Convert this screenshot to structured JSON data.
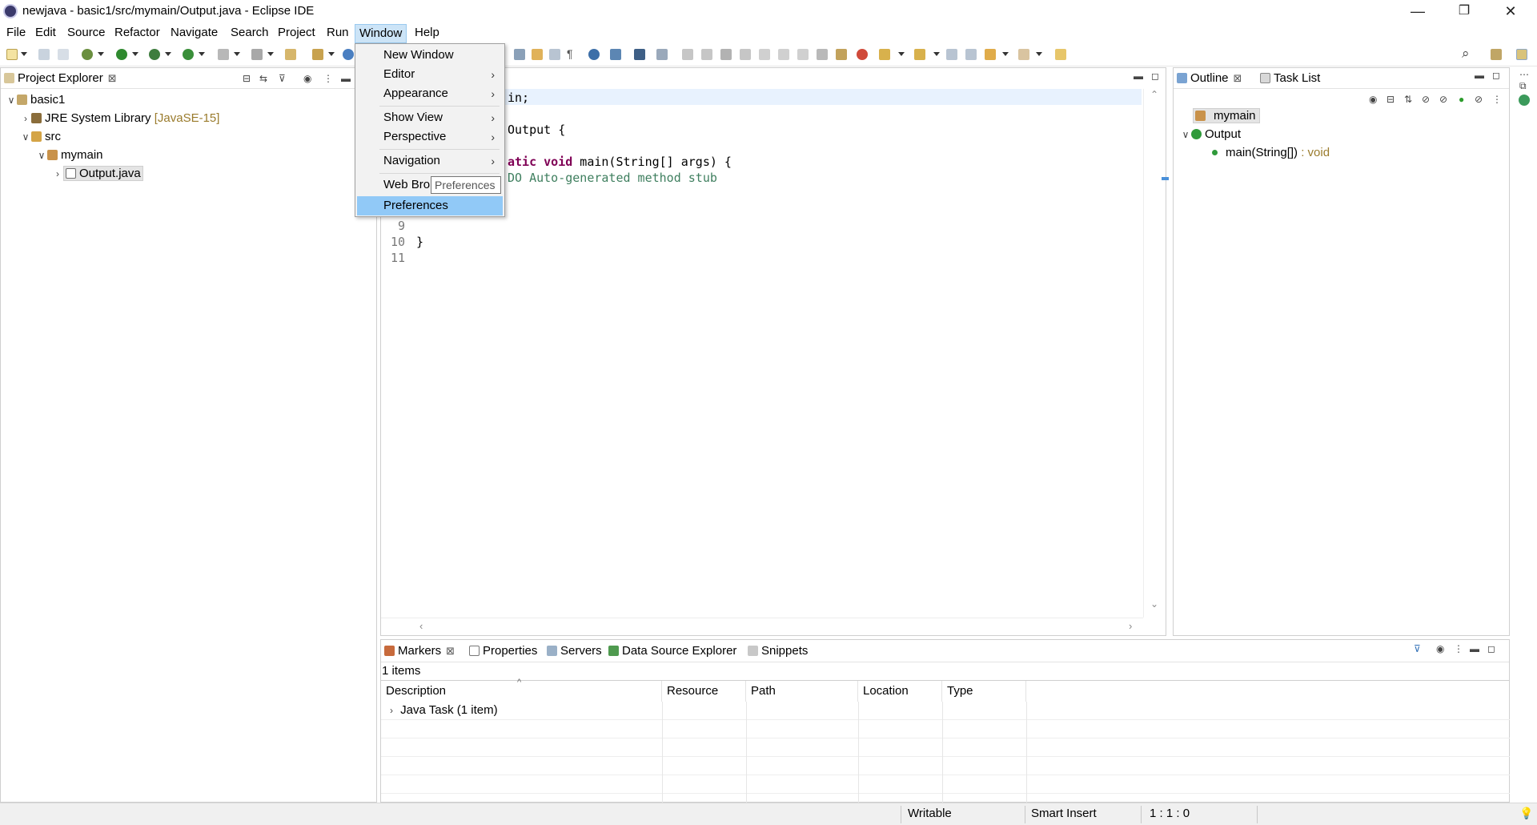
{
  "window": {
    "title": "newjava - basic1/src/mymain/Output.java - Eclipse IDE",
    "minimize": "—",
    "restore": "❐",
    "close": "✕"
  },
  "menubar": [
    "File",
    "Edit",
    "Source",
    "Refactor",
    "Navigate",
    "Search",
    "Project",
    "Run",
    "Window",
    "Help"
  ],
  "active_menu": "Window",
  "window_menu": {
    "items": [
      {
        "label": "New Window",
        "submenu": false
      },
      {
        "label": "Editor",
        "submenu": true
      },
      {
        "label": "Appearance",
        "submenu": true
      },
      {
        "label": "Show View",
        "submenu": true
      },
      {
        "label": "Perspective",
        "submenu": true
      },
      {
        "label": "Navigation",
        "submenu": true
      },
      {
        "label": "Web Bro",
        "submenu": false
      },
      {
        "label": "Preferences",
        "submenu": false
      }
    ],
    "selected": "Preferences",
    "tooltip": "Preferences"
  },
  "project_explorer": {
    "tab_label": "Project Explorer",
    "tree": [
      {
        "label": "basic1",
        "expanded": true,
        "icon": "project-icon"
      },
      {
        "label": "JRE System Library",
        "decoration": "[JavaSE-15]",
        "expanded": false,
        "icon": "library-icon"
      },
      {
        "label": "src",
        "expanded": true,
        "icon": "source-folder-icon"
      },
      {
        "label": "mymain",
        "expanded": true,
        "icon": "package-icon"
      },
      {
        "label": "Output.java",
        "expanded": false,
        "icon": "java-file-icon",
        "selected": true
      }
    ]
  },
  "editor": {
    "lines": [
      {
        "num": "",
        "text": "in;"
      },
      {
        "num": "",
        "text": "Output {"
      },
      {
        "num": "",
        "kw": "atic void",
        "text": " main(String[] args) {"
      },
      {
        "num": "",
        "comment": "DO Auto-generated method stub"
      },
      {
        "num": "9",
        "text": ""
      },
      {
        "num": "10",
        "text": "}"
      },
      {
        "num": "11",
        "text": ""
      }
    ]
  },
  "outline": {
    "tabs": [
      "Outline",
      "Task List"
    ],
    "tree": [
      {
        "label": "mymain",
        "icon": "package-icon"
      },
      {
        "label": "Output",
        "icon": "class-icon",
        "expanded": true
      },
      {
        "label": "main(String[])",
        "suffix": " : void",
        "icon": "method-icon"
      }
    ]
  },
  "bottom": {
    "tabs": [
      "Markers",
      "Properties",
      "Servers",
      "Data Source Explorer",
      "Snippets"
    ],
    "count": "1 items",
    "columns": [
      "Description",
      "Resource",
      "Path",
      "Location",
      "Type"
    ],
    "rows": [
      {
        "description": "Java Task (1 item)"
      }
    ]
  },
  "status": {
    "writable": "Writable",
    "insert_mode": "Smart Insert",
    "position": "1 : 1 : 0"
  },
  "colors": {
    "accent": "#cce4f7",
    "selection": "#91c9f7",
    "keyword": "#7f0055",
    "comment": "#3f7f5f",
    "decoration": "#9a7b2c"
  }
}
